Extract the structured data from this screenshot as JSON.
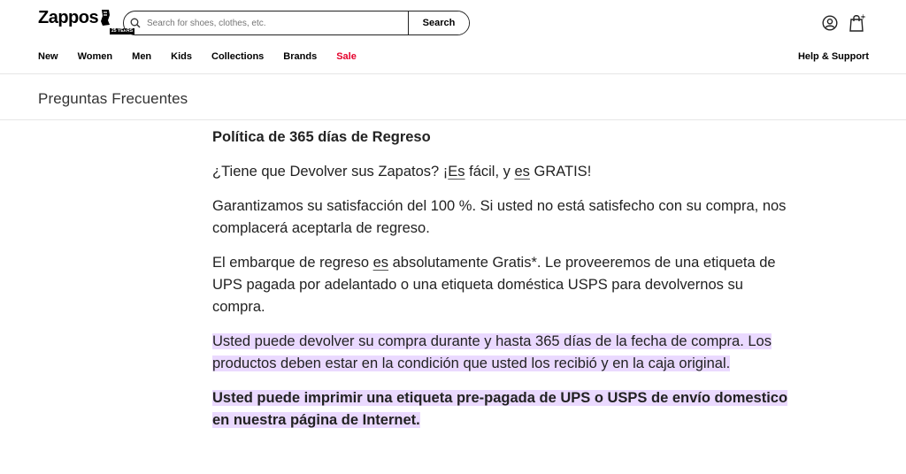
{
  "header": {
    "logo": {
      "text": "Zappos",
      "badge": "25 YEARS"
    },
    "search": {
      "placeholder": "Search for shoes, clothes, etc.",
      "value": "",
      "button_label": "Search"
    },
    "icons": {
      "account": "account-icon",
      "cart": "cart-icon"
    },
    "nav": [
      "New",
      "Women",
      "Men",
      "Kids",
      "Collections",
      "Brands",
      "Sale"
    ],
    "help_label": "Help & Support",
    "colors": {
      "sale": "#e4002b"
    }
  },
  "page": {
    "title": "Preguntas Frecuentes"
  },
  "faq": {
    "heading": "Política de 365 días de Regreso",
    "p1": {
      "a": "¿Tiene que Devolver sus Zapatos? ¡",
      "b": "Es",
      "c": " fácil, y ",
      "d": "es",
      "e": " GRATIS!"
    },
    "p2": "Garantizamos su satisfacción del 100 %. Si usted no está satisfecho con su compra, nos complacerá aceptarla de regreso.",
    "p3": {
      "a": "El embarque de regreso ",
      "b": "es",
      "c": " absolutamente Gratis*. Le proveeremos de una etiqueta de UPS pagada por adelantado o una etiqueta doméstica USPS para devolvernos su compra."
    },
    "p4": "Usted puede devolver su compra durante y hasta 365 días de la fecha de compra. Los productos deben estar en la condición que usted los recibió y en la caja original.",
    "p5": "Usted puede imprimir una etiqueta pre-pagada de UPS o USPS de envío domestico en nuestra página de Internet.",
    "highlight_color": "#ead9ff"
  }
}
